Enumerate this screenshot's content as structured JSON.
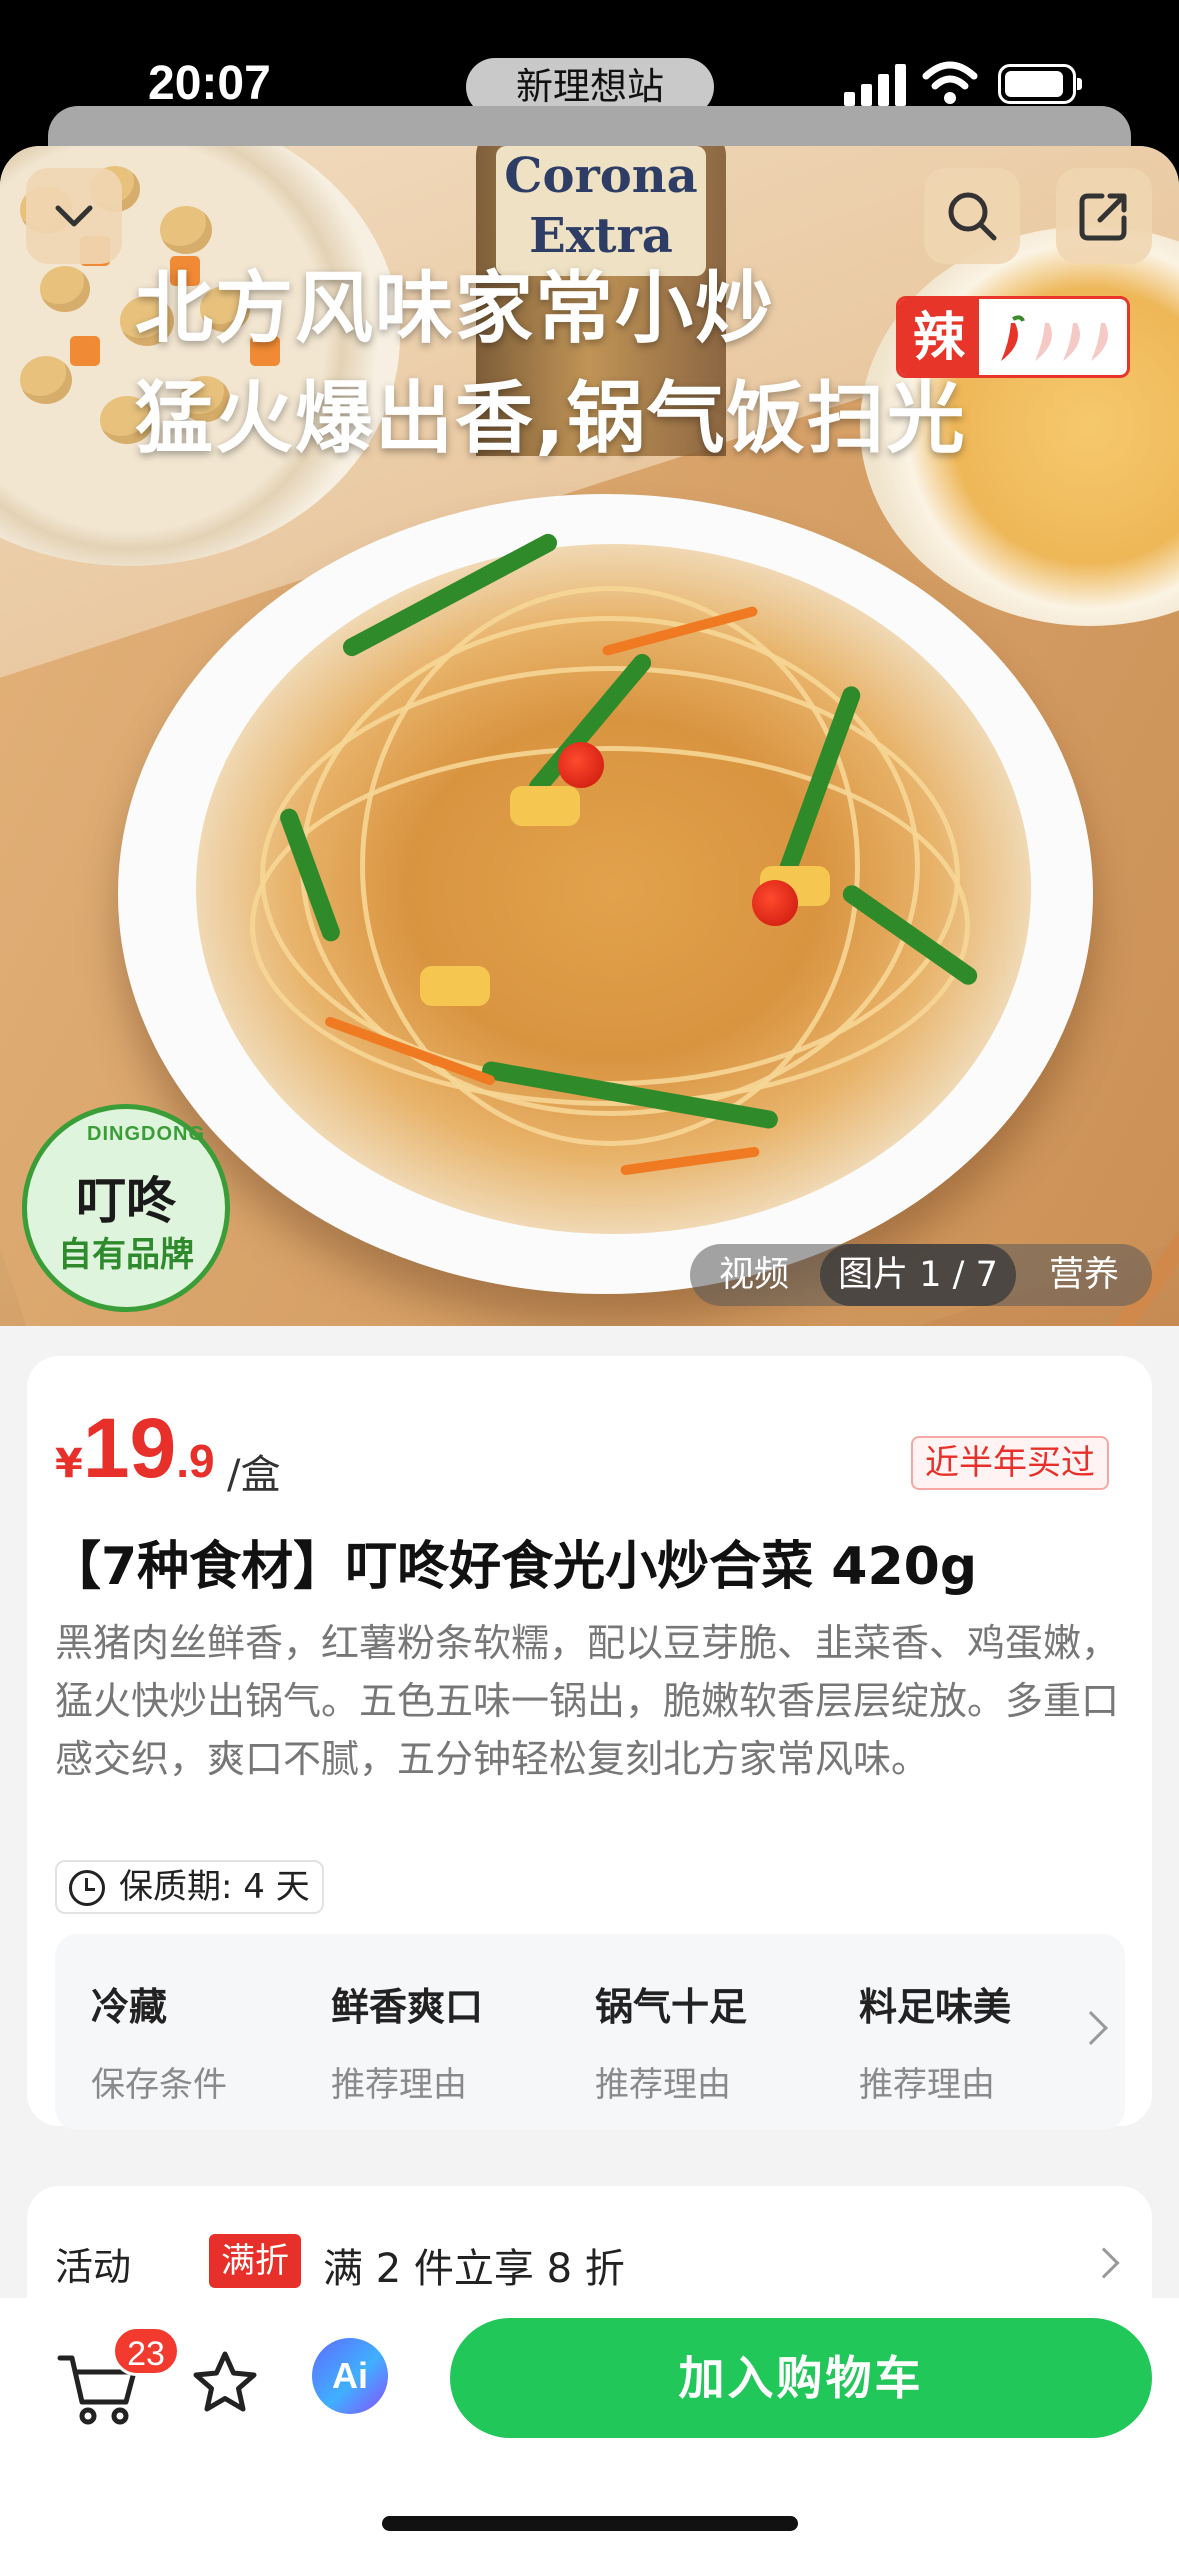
{
  "status_bar": {
    "time": "20:07",
    "island_label": "新理想站"
  },
  "hero": {
    "title": "北方风味家常小炒",
    "subtitle": "猛火爆出香,锅气饭扫光",
    "spicy_label": "辣",
    "spicy_level": 1,
    "spicy_max": 4,
    "bottle_text": "Corona Extra",
    "brand_ring": "DINGDONG",
    "brand_name": "叮咚",
    "brand_sub": "自有品牌",
    "media_tabs": [
      "视频",
      "图片 1 / 7",
      "营养"
    ],
    "active_media_tab": 1,
    "icons": [
      "chevron-down-icon",
      "search-icon",
      "share-icon"
    ]
  },
  "product": {
    "price_currency": "¥",
    "price_integer": "19",
    "price_decimal": ".9",
    "price_unit": "/盒",
    "sold_badge": "近半年买过",
    "title": "【7种食材】叮咚好食光小炒合菜 420g",
    "description": "黑猪肉丝鲜香，红薯粉条软糯，配以豆芽脆、韭菜香、鸡蛋嫩，猛火快炒出锅气。五色五味一锅出，脆嫩软香层层绽放。多重口感交织，爽口不腻，五分钟轻松复刻北方家常风味。",
    "shelf_life": "保质期: 4 天",
    "features": [
      {
        "title": "冷藏",
        "subtitle": "保存条件"
      },
      {
        "title": "鲜香爽口",
        "subtitle": "推荐理由"
      },
      {
        "title": "锅气十足",
        "subtitle": "推荐理由"
      },
      {
        "title": "料足味美",
        "subtitle": "推荐理由"
      }
    ]
  },
  "activity": {
    "label": "活动",
    "tag": "满折",
    "text": "满 2 件立享 8 折"
  },
  "bottom_bar": {
    "cart_count": "23",
    "ai_label": "Ai",
    "add_to_cart": "加入购物车"
  },
  "colors": {
    "price_red": "#e8302a",
    "brand_green": "#22c75a",
    "badge_red": "#f33a2f"
  }
}
